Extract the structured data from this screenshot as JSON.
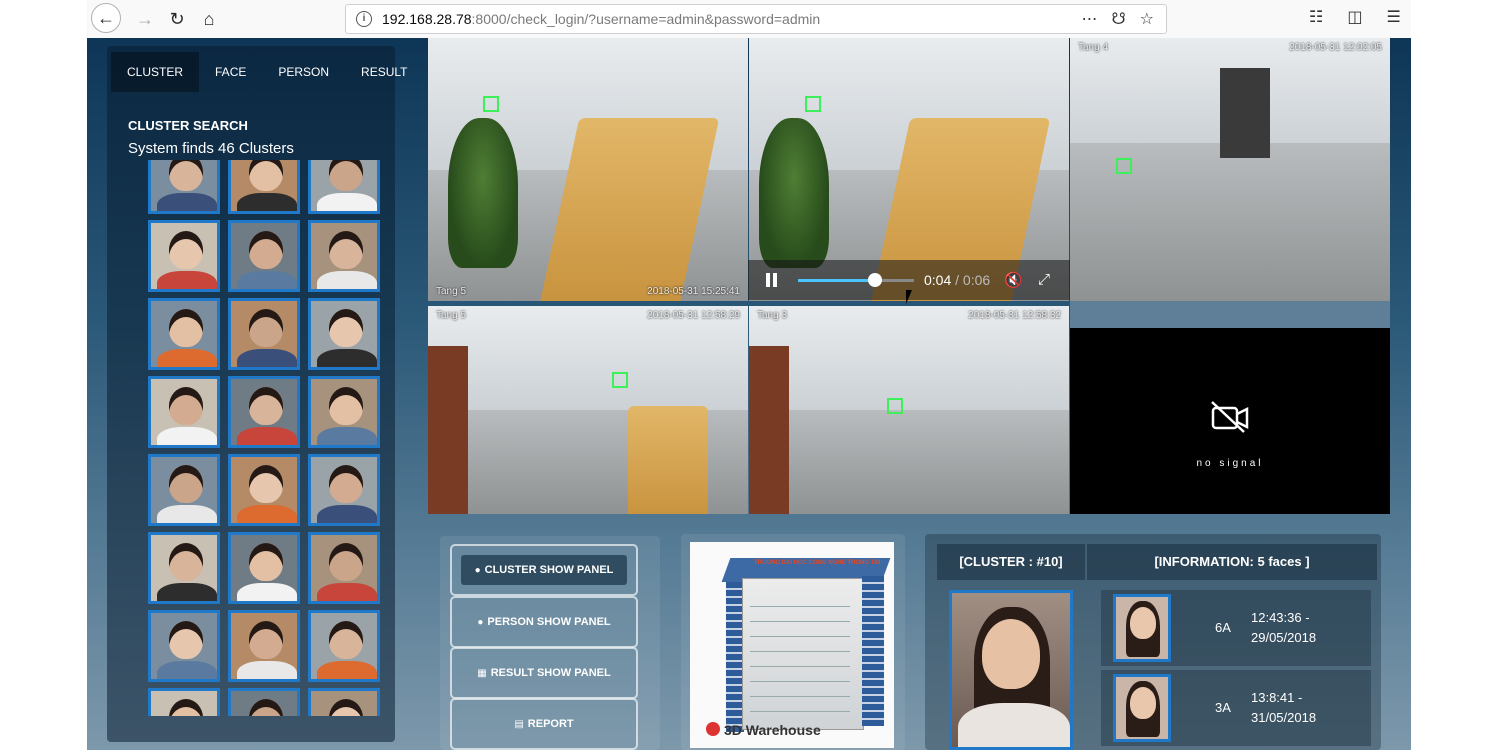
{
  "browser": {
    "url_host": "192.168.28.78",
    "url_rest": ":8000/check_login/?username=admin&password=admin"
  },
  "tabs": [
    {
      "label": "CLUSTER",
      "active": true
    },
    {
      "label": "FACE",
      "active": false
    },
    {
      "label": "PERSON",
      "active": false
    },
    {
      "label": "RESULT",
      "active": false
    }
  ],
  "cluster_search": {
    "title": "CLUSTER SEARCH",
    "subtitle": "System finds 46 Clusters"
  },
  "cameras": [
    {
      "label": "Tang 5",
      "timestamp": "2018-05-31 15:25:41"
    },
    {
      "label": "",
      "timestamp": ""
    },
    {
      "label": "Tang 4",
      "timestamp": "2018-05-31 12:02:05"
    },
    {
      "label": "Tang 5",
      "timestamp": "2018-05-31 12:58:29"
    },
    {
      "label": "Tang 3",
      "timestamp": "2018-05-31 12:58:32"
    }
  ],
  "player": {
    "current": "0:04",
    "total": " / 0:06",
    "progress": 0.66
  },
  "no_signal": "no signal",
  "panel_buttons": [
    {
      "label": "CLUSTER SHOW PANEL",
      "icon": "user-icon"
    },
    {
      "label": "PERSON SHOW PANEL",
      "icon": "person-icon"
    },
    {
      "label": "RESULT SHOW PANEL",
      "icon": "grid-icon"
    },
    {
      "label": "REPORT",
      "icon": "report-icon"
    }
  ],
  "building": {
    "sign": "TRUONG DAI HOC CONG NGHE THONG TIN",
    "warehouse": "3D Warehouse"
  },
  "info": {
    "cluster_header": "[CLUSTER : #10]",
    "info_header": "[INFORMATION: 5 faces ]",
    "rows": [
      {
        "zone": "6A",
        "time": "12:43:36 -",
        "date": "29/05/2018"
      },
      {
        "zone": "3A",
        "time": "13:8:41 -",
        "date": "31/05/2018"
      }
    ]
  },
  "colors": {
    "accent": "#1f78c8",
    "detection_box": "#3cf05a",
    "progress": "#4ac4ff"
  }
}
